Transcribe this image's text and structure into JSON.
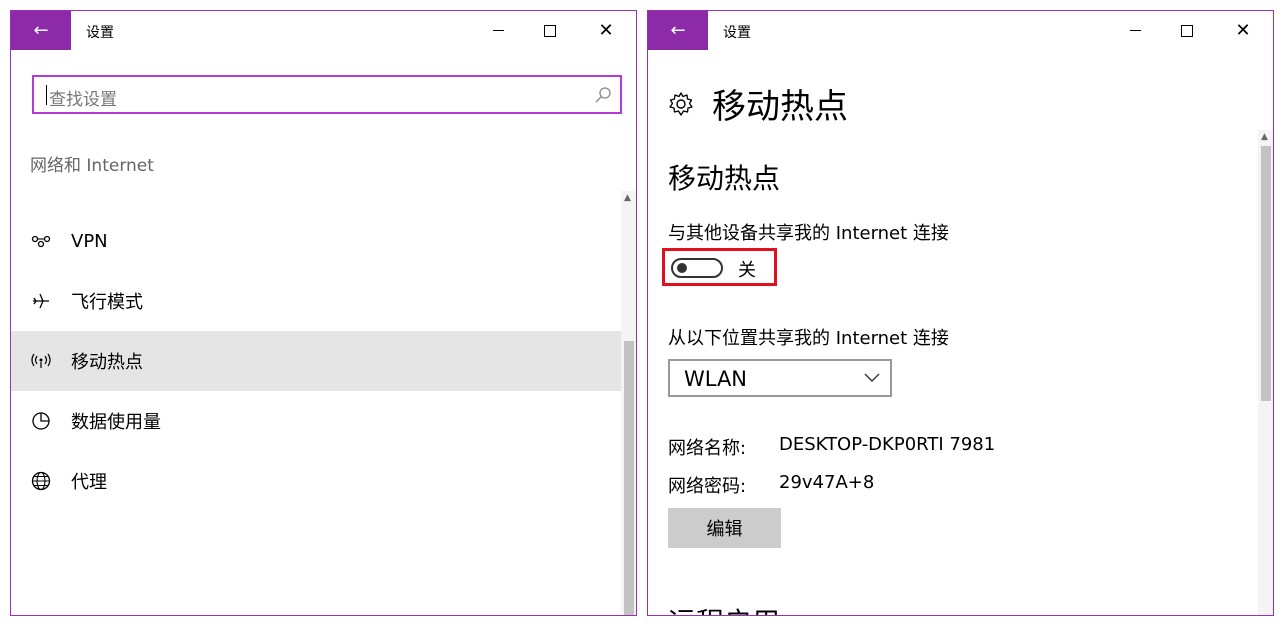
{
  "left_window": {
    "title": "设置",
    "search": {
      "placeholder": "查找设置"
    },
    "section_header": "网络和 Internet",
    "nav_items": [
      {
        "label": "VPN",
        "icon": "vpn-icon"
      },
      {
        "label": "飞行模式",
        "icon": "airplane-icon"
      },
      {
        "label": "移动热点",
        "icon": "hotspot-icon",
        "selected": true
      },
      {
        "label": "数据使用量",
        "icon": "data-usage-icon"
      },
      {
        "label": "代理",
        "icon": "globe-icon"
      }
    ]
  },
  "right_window": {
    "title": "设置",
    "page_title": "移动热点",
    "section_title": "移动热点",
    "share_label": "与其他设备共享我的 Internet 连接",
    "toggle_state": "关",
    "toggle_on": false,
    "from_label": "从以下位置共享我的 Internet 连接",
    "connection_select": "WLAN",
    "network_name_label": "网络名称:",
    "network_name": "DESKTOP-DKP0RTI 7981",
    "network_password_label": "网络密码:",
    "network_password": "29v47A+8",
    "edit_button": "编辑",
    "next_section_partial": "远程启用"
  },
  "colors": {
    "accent": "#8d2aa8",
    "search_border": "#b63ad6",
    "highlight_box": "#e0101f",
    "selected_bg": "#e5e5e5"
  }
}
